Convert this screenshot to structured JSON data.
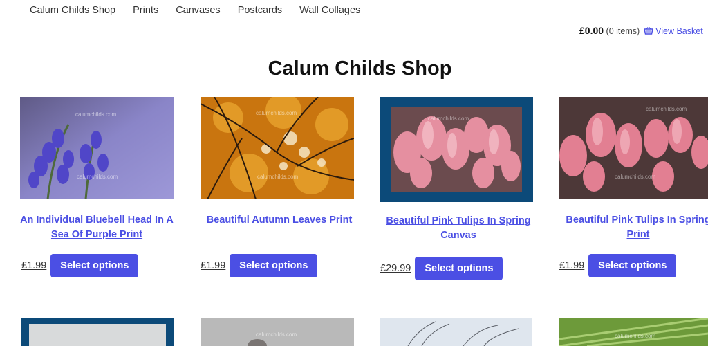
{
  "nav": [
    "Calum Childs Shop",
    "Prints",
    "Canvases",
    "Postcards",
    "Wall Collages"
  ],
  "cart": {
    "total": "£0.00",
    "items": "(0 items)",
    "basket_label": "View Basket"
  },
  "page_title": "Calum Childs Shop",
  "products": [
    {
      "title": "An Individual Bluebell Head In A Sea Of Purple Print",
      "price": "£1.99",
      "button": "Select options",
      "watermark": "calumchilds.com"
    },
    {
      "title": "Beautiful Autumn Leaves Print",
      "price": "£1.99",
      "button": "Select options",
      "watermark": "calumchilds.com"
    },
    {
      "title": "Beautiful Pink Tulips In Spring Canvas",
      "price": "£29.99",
      "button": "Select options",
      "watermark": "calumchilds.com"
    },
    {
      "title": "Beautiful Pink Tulips In Spring Print",
      "price": "£1.99",
      "button": "Select options",
      "watermark": "calumchilds.com"
    }
  ],
  "lower_watermark": "calumchilds.com",
  "colors": {
    "accent": "#4B4FE4"
  }
}
